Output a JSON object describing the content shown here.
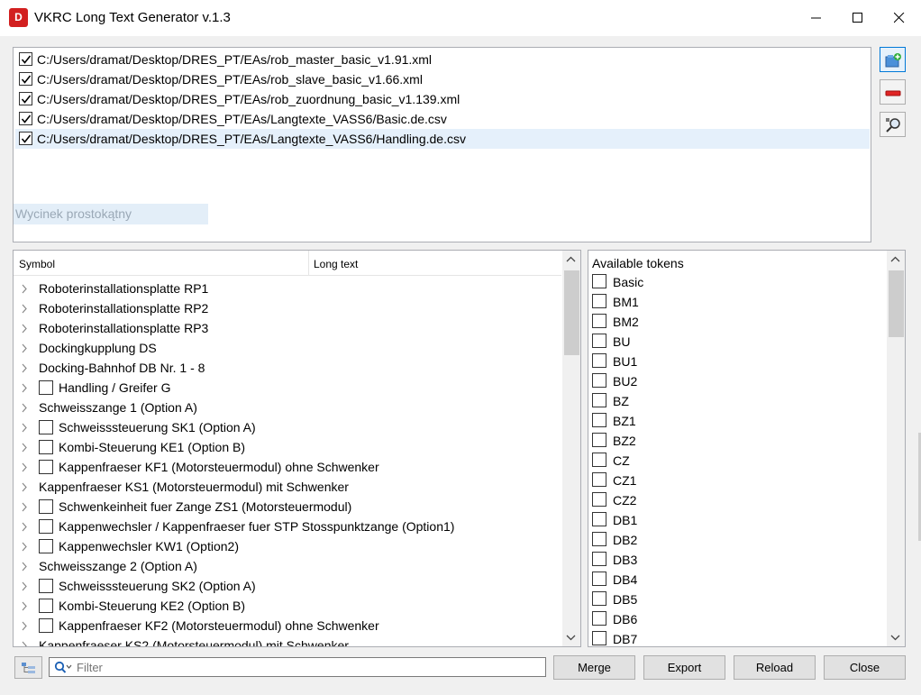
{
  "window": {
    "title": "VKRC Long Text Generator v.1.3",
    "icon": "app-logo-icon"
  },
  "files": [
    {
      "path": "C:/Users/dramat/Desktop/DRES_PT/EAs/rob_master_basic_v1.91.xml",
      "checked": true
    },
    {
      "path": "C:/Users/dramat/Desktop/DRES_PT/EAs/rob_slave_basic_v1.66.xml",
      "checked": true
    },
    {
      "path": "C:/Users/dramat/Desktop/DRES_PT/EAs/rob_zuordnung_basic_v1.139.xml",
      "checked": true
    },
    {
      "path": "C:/Users/dramat/Desktop/DRES_PT/EAs/Langtexte_VASS6/Basic.de.csv",
      "checked": true
    },
    {
      "path": "C:/Users/dramat/Desktop/DRES_PT/EAs/Langtexte_VASS6/Handling.de.csv",
      "checked": true,
      "selected": true
    }
  ],
  "ghost_tooltip": "Wycinek prostokątny",
  "toolbar": [
    "add-file-icon",
    "remove-icon",
    "inspect-icon"
  ],
  "tree": {
    "columns": [
      "Symbol",
      "Long text"
    ],
    "rows": [
      {
        "label": "Roboterinstallationsplatte RP1",
        "checkbox": false
      },
      {
        "label": "Roboterinstallationsplatte RP2",
        "checkbox": false
      },
      {
        "label": "Roboterinstallationsplatte RP3",
        "checkbox": false
      },
      {
        "label": "Dockingkupplung DS",
        "checkbox": false
      },
      {
        "label": "Docking-Bahnhof DB Nr. 1 - 8",
        "checkbox": false
      },
      {
        "label": "Handling / Greifer G",
        "checkbox": true
      },
      {
        "label": "Schweisszange 1 (Option A)",
        "checkbox": false
      },
      {
        "label": "Schweisssteuerung SK1 (Option A)",
        "checkbox": true
      },
      {
        "label": "Kombi-Steuerung KE1 (Option B)",
        "checkbox": true
      },
      {
        "label": "Kappenfraeser KF1 (Motorsteuermodul) ohne Schwenker",
        "checkbox": true
      },
      {
        "label": "Kappenfraeser KS1 (Motorsteuermodul) mit Schwenker",
        "checkbox": false
      },
      {
        "label": "Schwenkeinheit fuer Zange ZS1 (Motorsteuermodul)",
        "checkbox": true
      },
      {
        "label": "Kappenwechsler / Kappenfraeser fuer STP Stosspunktzange (Option1)",
        "checkbox": true
      },
      {
        "label": "Kappenwechsler KW1 (Option2)",
        "checkbox": true
      },
      {
        "label": "Schweisszange 2 (Option A)",
        "checkbox": false
      },
      {
        "label": "Schweisssteuerung SK2 (Option A)",
        "checkbox": true
      },
      {
        "label": "Kombi-Steuerung KE2 (Option B)",
        "checkbox": true
      },
      {
        "label": "Kappenfraeser KF2 (Motorsteuermodul) ohne Schwenker",
        "checkbox": true
      },
      {
        "label": "Kappenfraeser KS2 (Motorsteuermodul) mit Schwenker",
        "checkbox": false
      }
    ]
  },
  "tokens": {
    "header": "Available tokens",
    "items": [
      "Basic",
      "BM1",
      "BM2",
      "BU",
      "BU1",
      "BU2",
      "BZ",
      "BZ1",
      "BZ2",
      "CZ",
      "CZ1",
      "CZ2",
      "DB1",
      "DB2",
      "DB3",
      "DB4",
      "DB5",
      "DB6",
      "DB7"
    ]
  },
  "filter": {
    "placeholder": "Filter",
    "value": ""
  },
  "buttons": {
    "merge": "Merge",
    "export": "Export",
    "reload": "Reload",
    "close": "Close"
  }
}
